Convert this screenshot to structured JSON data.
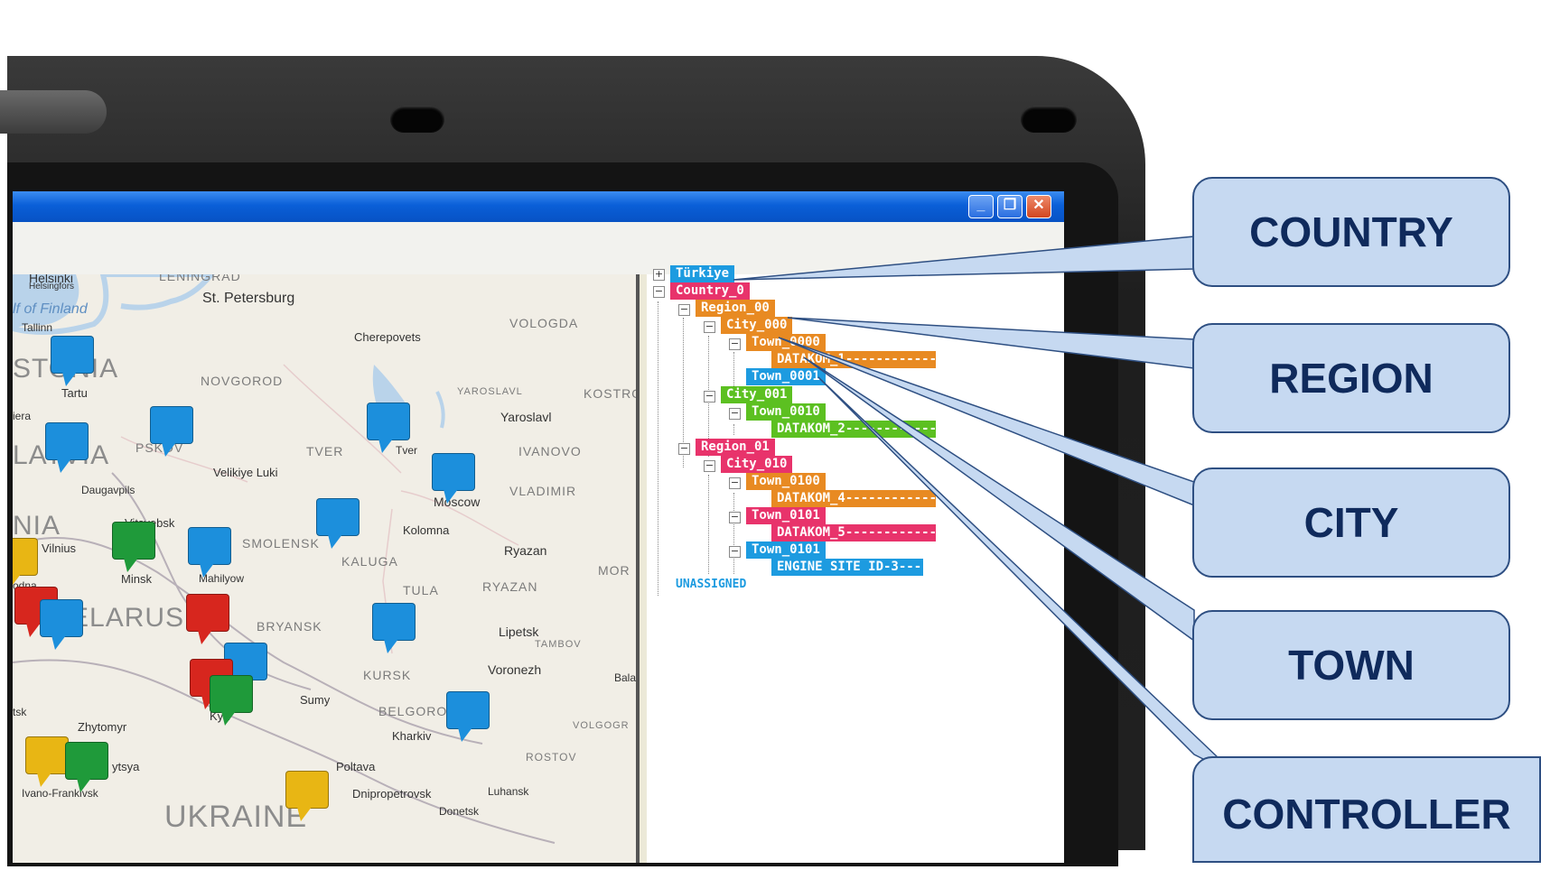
{
  "window": {
    "minimize_label": "_",
    "restore_label": "❐",
    "close_label": "✕"
  },
  "map": {
    "water_labels": [
      "lf of Finland"
    ],
    "big_labels": [
      "STONIA",
      "LATVIA",
      "NIA",
      "ELARUS",
      "UKRAINE"
    ],
    "region_labels": [
      "LENINGRAD",
      "VOLOGDA",
      "NOVGOROD",
      "YAROSLAVL",
      "KOSTRO",
      "TVER",
      "IVANOVO",
      "PSKOV",
      "VLADIMIR",
      "SMOLENSK",
      "KALUGA",
      "MOR",
      "TULA",
      "RYAZAN",
      "BRYANSK",
      "TAMBOV",
      "KURSK",
      "BELGOROD",
      "VOLGOGR",
      "ROSTOV"
    ],
    "city_labels": [
      "Helsinki",
      "Helsingfors",
      "St. Petersburg",
      "Tallinn",
      "Cherepovets",
      "Tartu",
      "Yaroslavl",
      "Tver",
      "Velikiye Luki",
      "Daugavpils",
      "Moscow",
      "Vitsyebsk",
      "Kolomna",
      "Vilnius",
      "Minsk",
      "Mahilyow",
      "Ryazan",
      "Lipetsk",
      "Voronezh",
      "Bala",
      "Sumy",
      "Kyiv",
      "Zhytomyr",
      "Kharkiv",
      "Poltava",
      "Ivano-Frankivsk",
      "Dnipropetrovsk",
      "Luhansk",
      "Donetsk",
      "odna",
      "ytsya",
      "tsk",
      "iera"
    ],
    "pin_colors": {
      "blue": "#1c8fdc",
      "green": "#1f9a3a",
      "red": "#d7261e",
      "yellow": "#e8b614"
    }
  },
  "tree": {
    "nodes": [
      {
        "label": "Türkiye",
        "color": "#1d9be0"
      },
      {
        "label": "Country_0",
        "color": "#e8336b"
      },
      {
        "label": "Region_00",
        "color": "#e88a22"
      },
      {
        "label": "City_000",
        "color": "#e88a22"
      },
      {
        "label": "Town_0000",
        "color": "#e88a22"
      },
      {
        "label": "DATAKOM_1------------",
        "color": "#e88a22"
      },
      {
        "label": "Town_0001",
        "color": "#1d9be0"
      },
      {
        "label": "City_001",
        "color": "#5cc021"
      },
      {
        "label": "Town_0010",
        "color": "#5cc021"
      },
      {
        "label": "DATAKOM_2------------",
        "color": "#5cc021"
      },
      {
        "label": "Region_01",
        "color": "#e8336b"
      },
      {
        "label": "City_010",
        "color": "#e8336b"
      },
      {
        "label": "Town_0100",
        "color": "#e88a22"
      },
      {
        "label": "DATAKOM_4------------",
        "color": "#e88a22"
      },
      {
        "label": "Town_0101",
        "color": "#e8336b"
      },
      {
        "label": "DATAKOM_5------------",
        "color": "#e8336b"
      },
      {
        "label": "Town_0101",
        "color": "#1d9be0"
      },
      {
        "label": "ENGINE SITE ID-3-----",
        "color": "#1d9be0"
      }
    ],
    "unassigned_label": "UNASSIGNED"
  },
  "callouts": {
    "country": "COUNTRY",
    "region": "REGION",
    "city": "CITY",
    "town": "TOWN",
    "controller": "CONTROLLER"
  },
  "colors": {
    "callout_fill": "#c6d9f1",
    "callout_border": "#2e4f82",
    "callout_text": "#0f2a5c",
    "titlebar": "#0a5fd8"
  }
}
